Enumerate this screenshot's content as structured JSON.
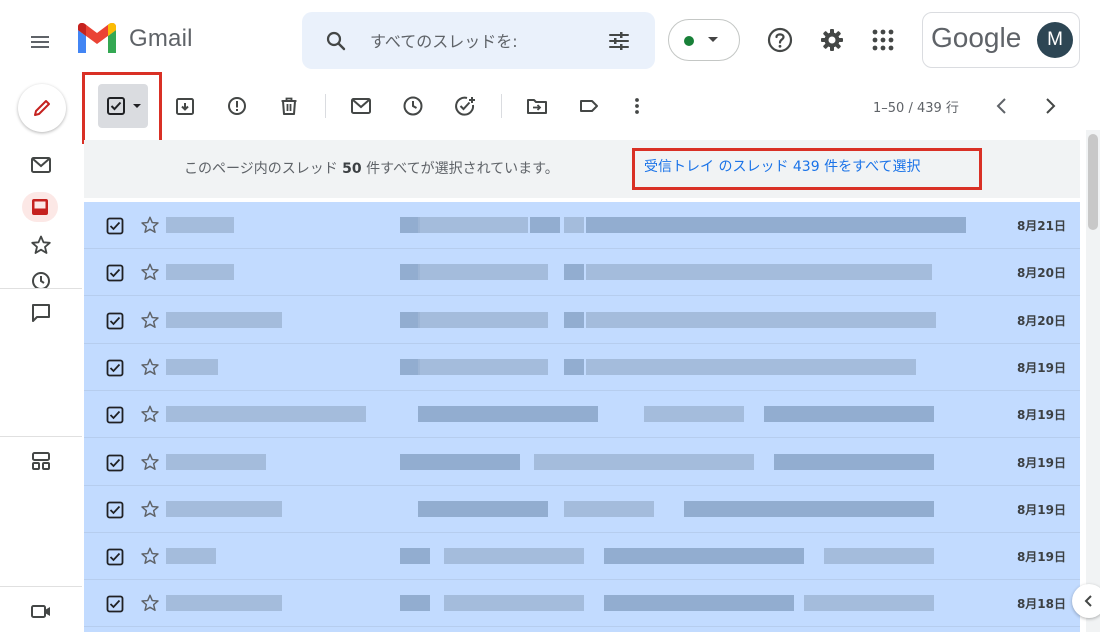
{
  "header": {
    "app_name": "Gmail",
    "search_placeholder": "すべてのスレッドを:",
    "account_brand": "Google",
    "avatar_initial": "M",
    "status_color": "#188038"
  },
  "toolbar": {
    "icons": [
      "select-all-checkbox-icon",
      "archive-icon",
      "report-spam-icon",
      "delete-icon",
      "mark-unread-icon",
      "snooze-icon",
      "add-task-icon",
      "move-to-icon",
      "label-icon",
      "more-vert-icon"
    ],
    "pager": "1–50 / 439 行"
  },
  "banner": {
    "text_prefix": "このページ内のスレッド ",
    "text_count": "50",
    "text_suffix": " 件すべてが選択されています。",
    "select_all_link": "受信トレイ のスレッド 439 件をすべて選択"
  },
  "emails": [
    {
      "date": "8月21日"
    },
    {
      "date": "8月20日"
    },
    {
      "date": "8月20日"
    },
    {
      "date": "8月19日"
    },
    {
      "date": "8月19日"
    },
    {
      "date": "8月19日"
    },
    {
      "date": "8月19日"
    },
    {
      "date": "8月19日"
    },
    {
      "date": "8月18日"
    }
  ],
  "colors": {
    "selected_row": "#c2dbff",
    "highlight_frame": "#d93025",
    "link": "#1a73e8"
  }
}
